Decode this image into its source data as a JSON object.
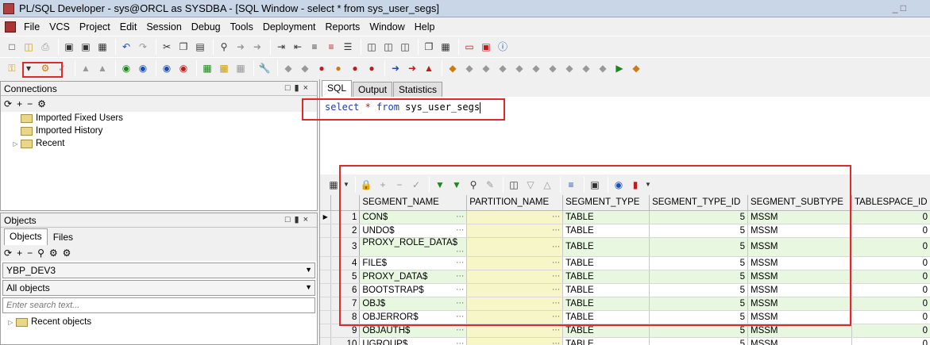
{
  "window": {
    "title": "PL/SQL Developer - sys@ORCL as SYSDBA - [SQL Window - select * from sys_user_segs]",
    "title_right": "_ □"
  },
  "menu": {
    "items": [
      "File",
      "VCS",
      "Project",
      "Edit",
      "Session",
      "Debug",
      "Tools",
      "Deployment",
      "Reports",
      "Window",
      "Help"
    ]
  },
  "connections": {
    "header": "Connections",
    "tree": [
      "Imported Fixed Users",
      "Imported History",
      "Recent"
    ]
  },
  "objects": {
    "header": "Objects",
    "tabs": [
      "Objects",
      "Files"
    ],
    "user_select": "YBP_DEV3",
    "filter_select": "All objects",
    "search_placeholder": "Enter search text...",
    "tree": [
      "Recent objects"
    ]
  },
  "editor": {
    "tabs": [
      "SQL",
      "Output",
      "Statistics"
    ],
    "sql": {
      "kw1": "select",
      "star": " * ",
      "kw2": "from",
      "table": " sys_user_segs"
    }
  },
  "grid": {
    "columns": [
      "SEGMENT_NAME",
      "PARTITION_NAME",
      "SEGMENT_TYPE",
      "SEGMENT_TYPE_ID",
      "SEGMENT_SUBTYPE",
      "TABLESPACE_ID"
    ],
    "rows": [
      {
        "n": "1",
        "segment_name": "CON$",
        "partition_name": "",
        "segment_type": "TABLE",
        "segment_type_id": "5",
        "segment_subtype": "MSSM",
        "tablespace_id": "0"
      },
      {
        "n": "2",
        "segment_name": "UNDO$",
        "partition_name": "",
        "segment_type": "TABLE",
        "segment_type_id": "5",
        "segment_subtype": "MSSM",
        "tablespace_id": "0"
      },
      {
        "n": "3",
        "segment_name": "PROXY_ROLE_DATA$",
        "partition_name": "",
        "segment_type": "TABLE",
        "segment_type_id": "5",
        "segment_subtype": "MSSM",
        "tablespace_id": "0"
      },
      {
        "n": "4",
        "segment_name": "FILE$",
        "partition_name": "",
        "segment_type": "TABLE",
        "segment_type_id": "5",
        "segment_subtype": "MSSM",
        "tablespace_id": "0"
      },
      {
        "n": "5",
        "segment_name": "PROXY_DATA$",
        "partition_name": "",
        "segment_type": "TABLE",
        "segment_type_id": "5",
        "segment_subtype": "MSSM",
        "tablespace_id": "0"
      },
      {
        "n": "6",
        "segment_name": "BOOTSTRAP$",
        "partition_name": "",
        "segment_type": "TABLE",
        "segment_type_id": "5",
        "segment_subtype": "MSSM",
        "tablespace_id": "0"
      },
      {
        "n": "7",
        "segment_name": "OBJ$",
        "partition_name": "",
        "segment_type": "TABLE",
        "segment_type_id": "5",
        "segment_subtype": "MSSM",
        "tablespace_id": "0"
      },
      {
        "n": "8",
        "segment_name": "OBJERROR$",
        "partition_name": "",
        "segment_type": "TABLE",
        "segment_type_id": "5",
        "segment_subtype": "MSSM",
        "tablespace_id": "0"
      },
      {
        "n": "9",
        "segment_name": "OBJAUTH$",
        "partition_name": "",
        "segment_type": "TABLE",
        "segment_type_id": "5",
        "segment_subtype": "MSSM",
        "tablespace_id": "0"
      },
      {
        "n": "10",
        "segment_name": "UGROUP$",
        "partition_name": "",
        "segment_type": "TABLE",
        "segment_type_id": "5",
        "segment_subtype": "MSSM",
        "tablespace_id": "0"
      }
    ],
    "ellipsis": "⋯"
  },
  "colors": {
    "annotation_red": "#e0292b",
    "row_green": "#e8f7e0",
    "partition_yellow": "#f6f6c8",
    "sql_keyword": "#1a3fa8"
  }
}
